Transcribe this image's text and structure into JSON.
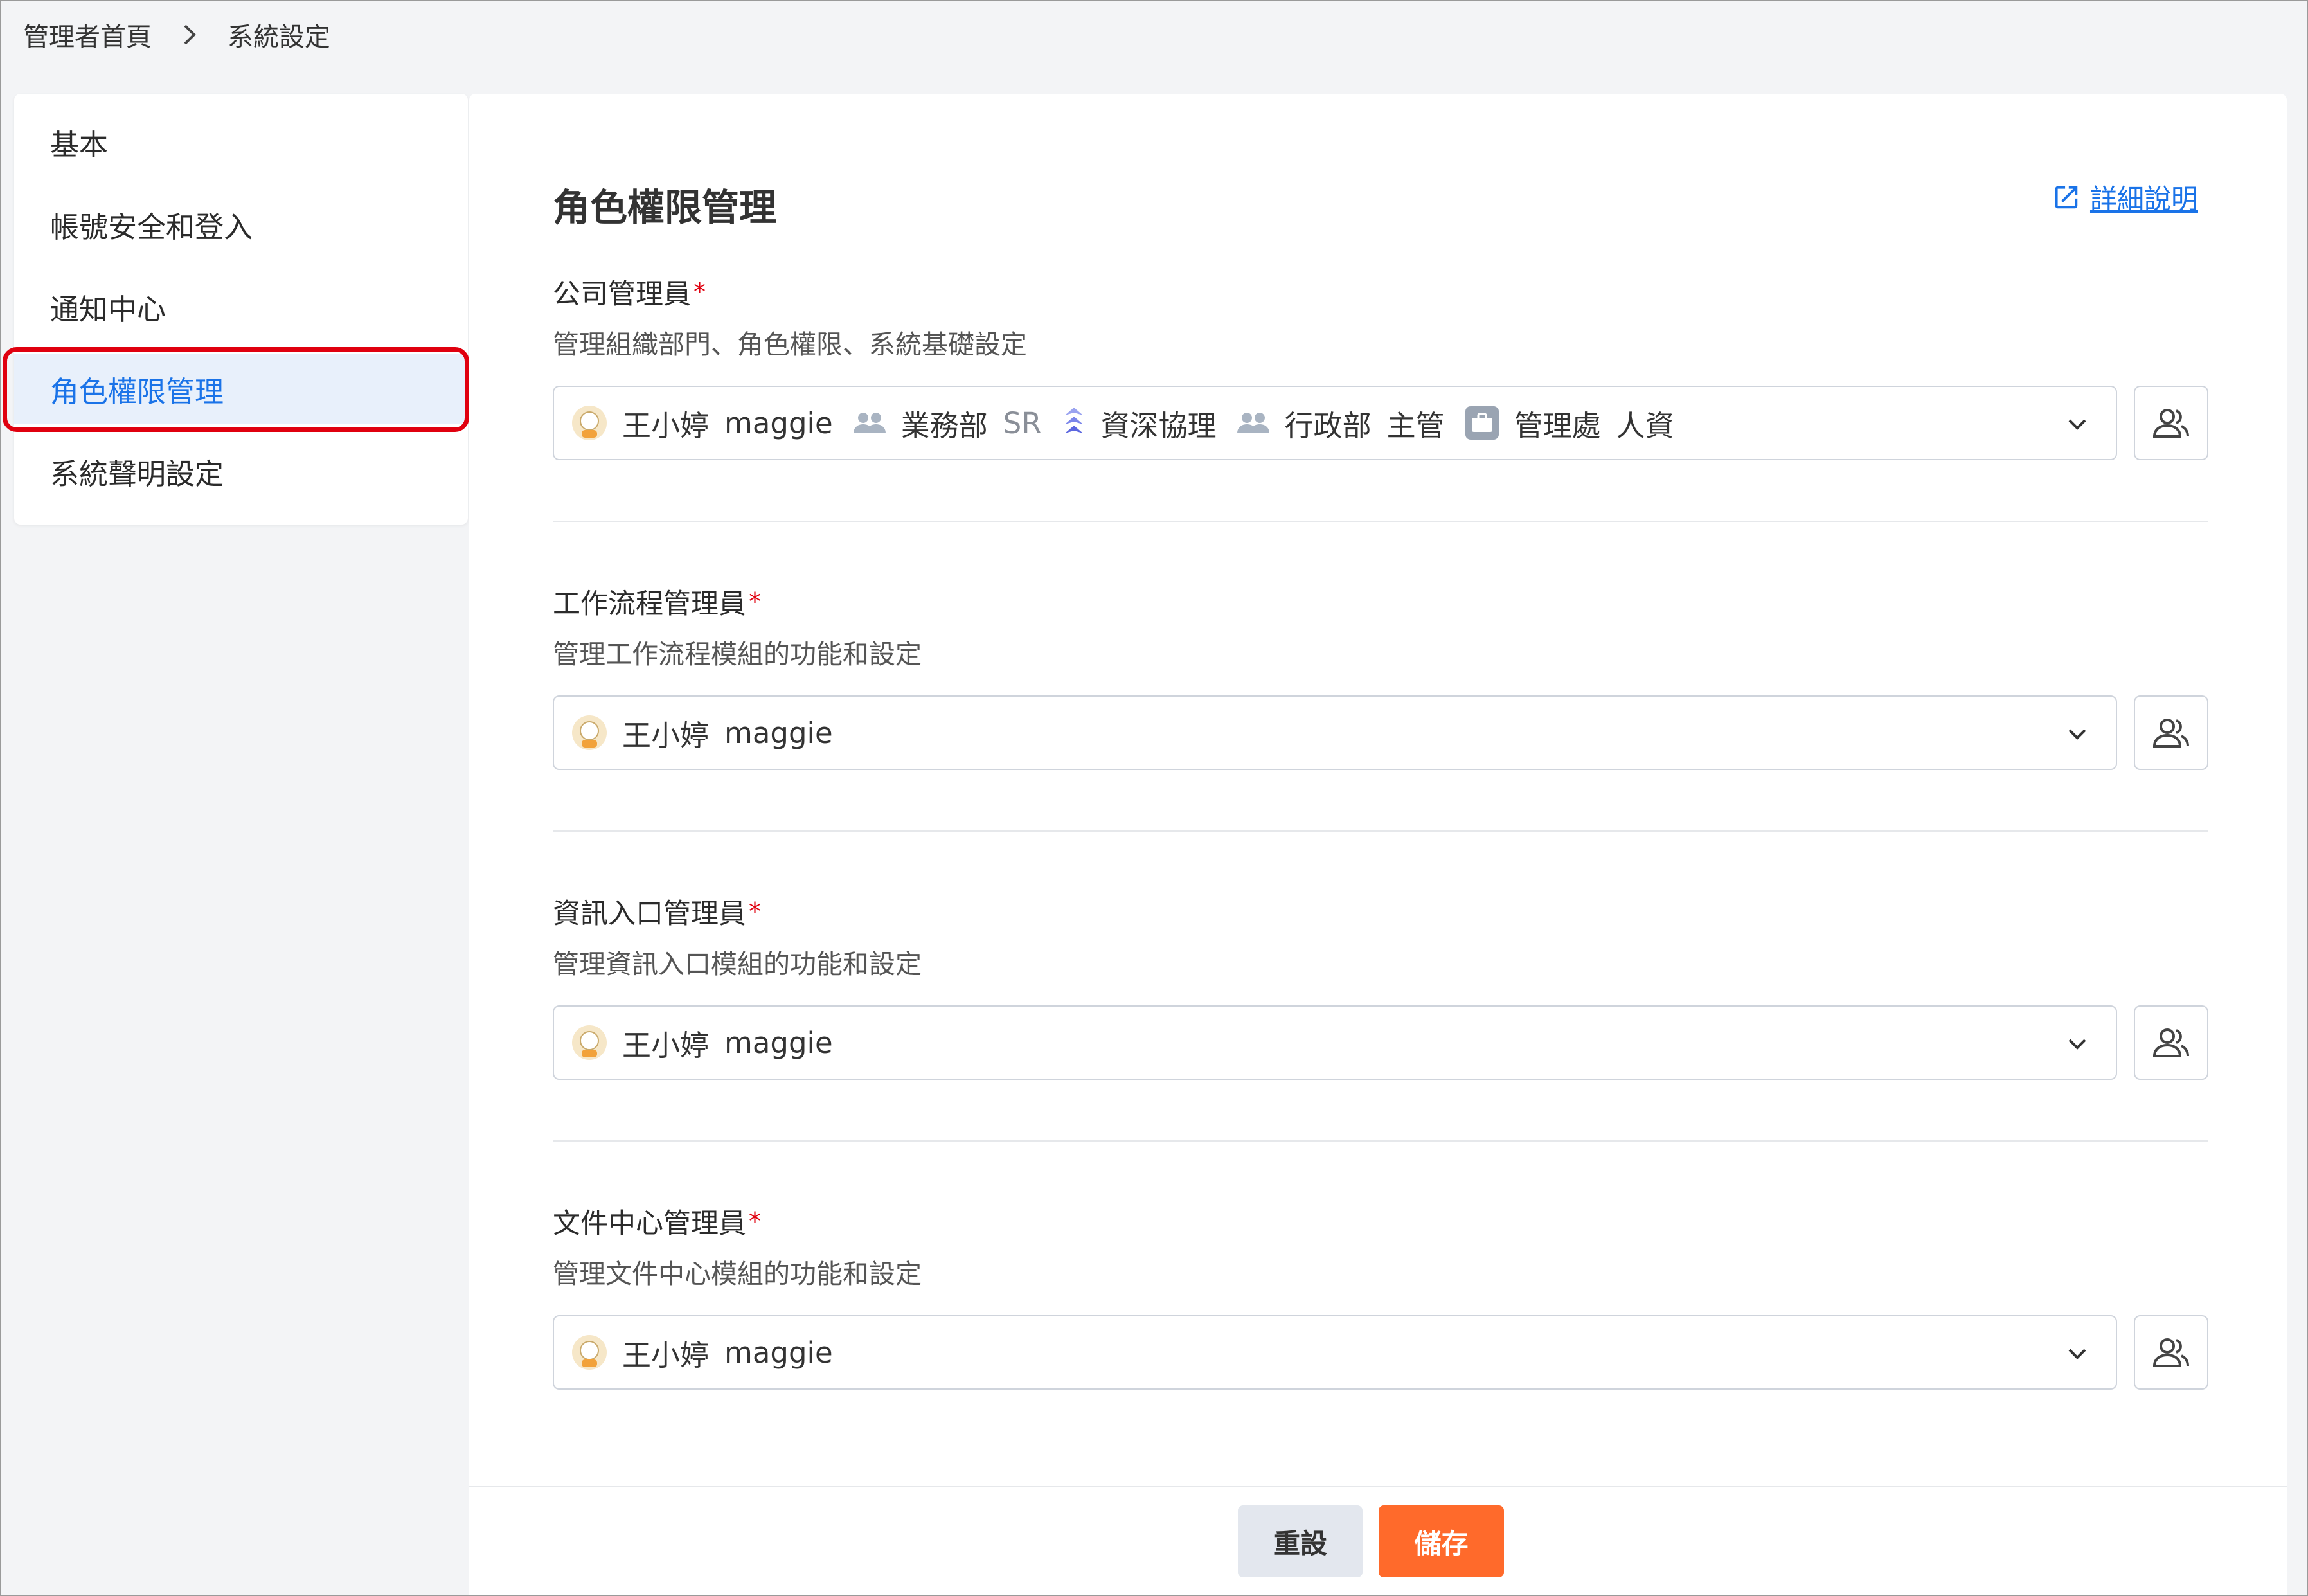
{
  "breadcrumb": {
    "home": "管理者首頁",
    "current": "系統設定"
  },
  "sidebar": {
    "items": [
      {
        "label": "基本"
      },
      {
        "label": "帳號安全和登入"
      },
      {
        "label": "通知中心"
      },
      {
        "label": "角色權限管理",
        "active": true
      },
      {
        "label": "系統聲明設定"
      }
    ]
  },
  "main": {
    "title": "角色權限管理",
    "help_link": "詳細說明",
    "required_mark": "*",
    "sections": [
      {
        "title": "公司管理員",
        "description": "管理組織部門、角色權限、系統基礎設定",
        "chips": [
          {
            "icon": "avatar-icon",
            "name": "王小婷",
            "sub": "maggie"
          },
          {
            "icon": "group-icon",
            "name": "業務部",
            "sub": "SR"
          },
          {
            "icon": "rank-icon",
            "name": "資深協理"
          },
          {
            "icon": "group-icon",
            "name": "行政部",
            "sub": "主管"
          },
          {
            "icon": "briefcase-icon",
            "name": "管理處",
            "sub": "人資"
          }
        ]
      },
      {
        "title": "工作流程管理員",
        "description": "管理工作流程模組的功能和設定",
        "chips": [
          {
            "icon": "avatar-icon",
            "name": "王小婷",
            "sub": "maggie"
          }
        ]
      },
      {
        "title": "資訊入口管理員",
        "description": "管理資訊入口模組的功能和設定",
        "chips": [
          {
            "icon": "avatar-icon",
            "name": "王小婷",
            "sub": "maggie"
          }
        ]
      },
      {
        "title": "文件中心管理員",
        "description": "管理文件中心模組的功能和設定",
        "chips": [
          {
            "icon": "avatar-icon",
            "name": "王小婷",
            "sub": "maggie"
          }
        ]
      }
    ]
  },
  "footer": {
    "reset_label": "重設",
    "save_label": "儲存"
  },
  "colors": {
    "accent": "#1a73e8",
    "save": "#ff6a2b",
    "required": "#e0000f",
    "highlight": "#e0000f"
  }
}
